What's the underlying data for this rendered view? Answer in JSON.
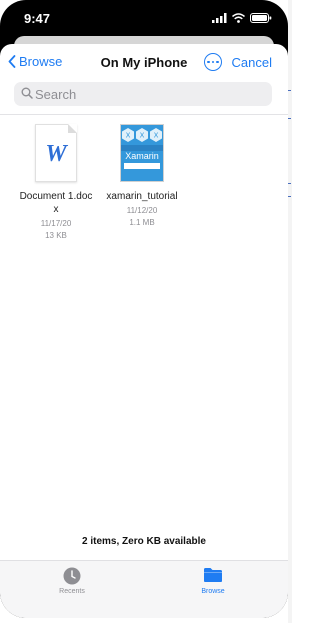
{
  "status_bar": {
    "time": "9:47",
    "icons": [
      "cellular-icon",
      "wifi-icon",
      "battery-icon"
    ]
  },
  "nav": {
    "back_label": "Browse",
    "title": "On My iPhone",
    "more_icon": "ellipsis-circle-icon",
    "cancel_label": "Cancel"
  },
  "search": {
    "placeholder": "Search",
    "icon": "search-icon"
  },
  "files": [
    {
      "name": "Document 1.docx",
      "date": "11/17/20",
      "size": "13 KB",
      "icon": "word-document-icon"
    },
    {
      "name": "xamarin_tutorial",
      "date": "11/12/20",
      "size": "1.1 MB",
      "icon": "xamarin-thumbnail",
      "thumb_text": "Xamarin"
    }
  ],
  "footer": {
    "status": "2 items, Zero KB available"
  },
  "tabs": [
    {
      "label": "Recents",
      "icon": "clock-icon",
      "selected": false
    },
    {
      "label": "Browse",
      "icon": "folder-icon",
      "selected": true
    }
  ],
  "colors": {
    "accent": "#1f7cf2",
    "secondary_text": "#8e8e93",
    "word_blue": "#2f6fd6",
    "xamarin_blue": "#3498db"
  }
}
